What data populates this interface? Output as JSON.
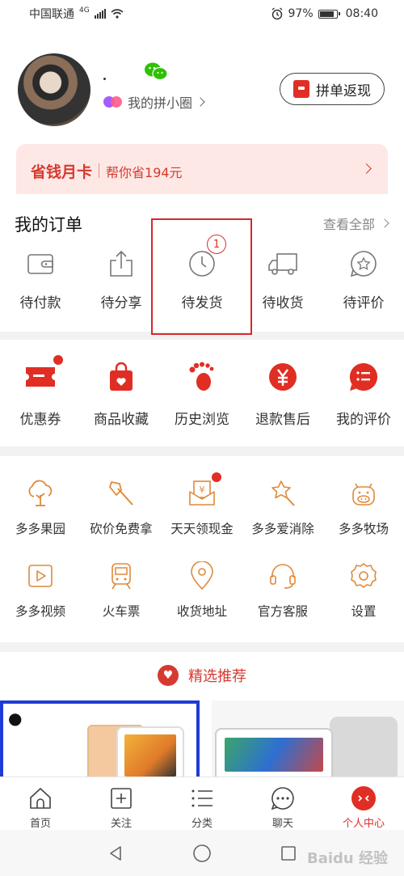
{
  "status_bar": {
    "carrier": "中国联通",
    "network": "4G",
    "battery_percent": "97%",
    "time": "08:40"
  },
  "profile": {
    "circle_label": "我的拼小圈",
    "cashback_label": "拼单返现"
  },
  "savings_card": {
    "title": "省钱月卡",
    "subtitle": "帮你省194元"
  },
  "orders": {
    "title": "我的订单",
    "view_all": "查看全部",
    "items": [
      {
        "label": "待付款",
        "icon": "wallet-icon"
      },
      {
        "label": "待分享",
        "icon": "share-icon"
      },
      {
        "label": "待发货",
        "icon": "clock-icon",
        "badge": "1"
      },
      {
        "label": "待收货",
        "icon": "truck-icon"
      },
      {
        "label": "待评价",
        "icon": "review-icon"
      }
    ]
  },
  "services": [
    {
      "label": "优惠券",
      "icon": "coupon-icon",
      "dot": true
    },
    {
      "label": "商品收藏",
      "icon": "favorite-bag-icon"
    },
    {
      "label": "历史浏览",
      "icon": "footprint-icon"
    },
    {
      "label": "退款售后",
      "icon": "refund-icon"
    },
    {
      "label": "我的评价",
      "icon": "comment-icon"
    }
  ],
  "tools_row1": [
    {
      "label": "多多果园",
      "icon": "tree-icon"
    },
    {
      "label": "砍价免费拿",
      "icon": "axe-icon"
    },
    {
      "label": "天天领现金",
      "icon": "cash-envelope-icon",
      "dot": true
    },
    {
      "label": "多多爱消除",
      "icon": "star-wand-icon"
    },
    {
      "label": "多多牧场",
      "icon": "cow-icon"
    }
  ],
  "tools_row2": [
    {
      "label": "多多视频",
      "icon": "video-icon"
    },
    {
      "label": "火车票",
      "icon": "train-icon"
    },
    {
      "label": "收货地址",
      "icon": "location-icon"
    },
    {
      "label": "官方客服",
      "icon": "headset-icon"
    },
    {
      "label": "设置",
      "icon": "settings-icon"
    }
  ],
  "recommend": {
    "title": "精选推荐"
  },
  "tabbar": [
    {
      "label": "首页",
      "icon": "home-icon"
    },
    {
      "label": "关注",
      "icon": "follow-icon"
    },
    {
      "label": "分类",
      "icon": "category-icon"
    },
    {
      "label": "聊天",
      "icon": "chat-icon"
    },
    {
      "label": "个人中心",
      "icon": "profile-icon",
      "active": true
    }
  ],
  "colors": {
    "accent": "#e02e24",
    "card_bg": "#fde8e6",
    "tool_orange": "#e0893a",
    "highlight": "#d6282e"
  },
  "watermark": "Baidu 经验"
}
